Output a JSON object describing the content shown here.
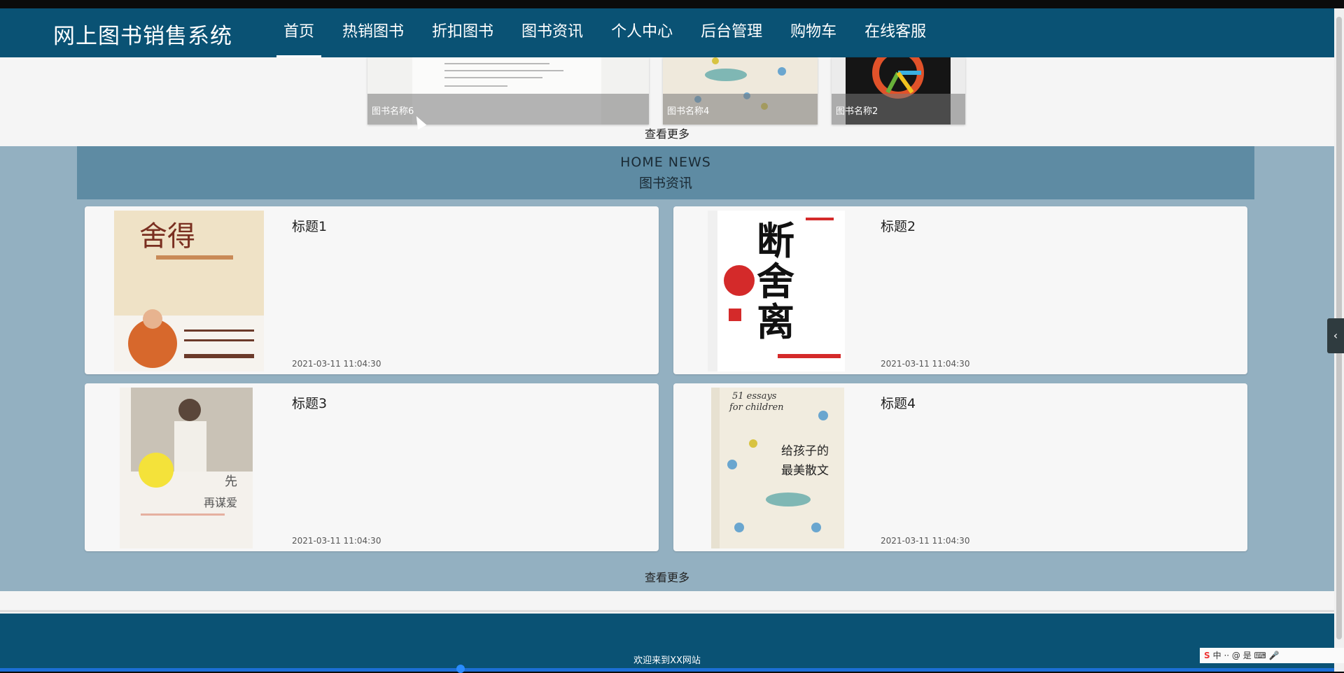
{
  "header": {
    "site_title": "网上图书销售系统",
    "nav": [
      {
        "label": "首页",
        "active": true
      },
      {
        "label": "热销图书"
      },
      {
        "label": "折扣图书"
      },
      {
        "label": "图书资讯"
      },
      {
        "label": "个人中心"
      },
      {
        "label": "后台管理"
      },
      {
        "label": "购物车"
      },
      {
        "label": "在线客服"
      }
    ]
  },
  "books_section": {
    "items": [
      {
        "caption": "图书名称6"
      },
      {
        "caption": "图书名称4"
      },
      {
        "caption": "图书名称2"
      }
    ],
    "more_label": "查看更多"
  },
  "news_section": {
    "heading_en": "HOME NEWS",
    "heading_cn": "图书资讯",
    "items": [
      {
        "title": "标题1",
        "date": "2021-03-11 11:04:30"
      },
      {
        "title": "标题2",
        "date": "2021-03-11 11:04:30"
      },
      {
        "title": "标题3",
        "date": "2021-03-11 11:04:30"
      },
      {
        "title": "标题4",
        "date": "2021-03-11 11:04:30"
      }
    ],
    "more_label": "查看更多"
  },
  "footer": {
    "text": "欢迎来到XX网站"
  },
  "side_tab": {
    "icon": "chevron-left-icon",
    "glyph": "‹"
  },
  "watermark": {
    "text": "中 ·· @ 是 ⌨ 🎤"
  },
  "colors": {
    "header_bg": "#0a5274",
    "news_bg": "#93b0c1",
    "news_head_bg": "#5e8ba3"
  }
}
